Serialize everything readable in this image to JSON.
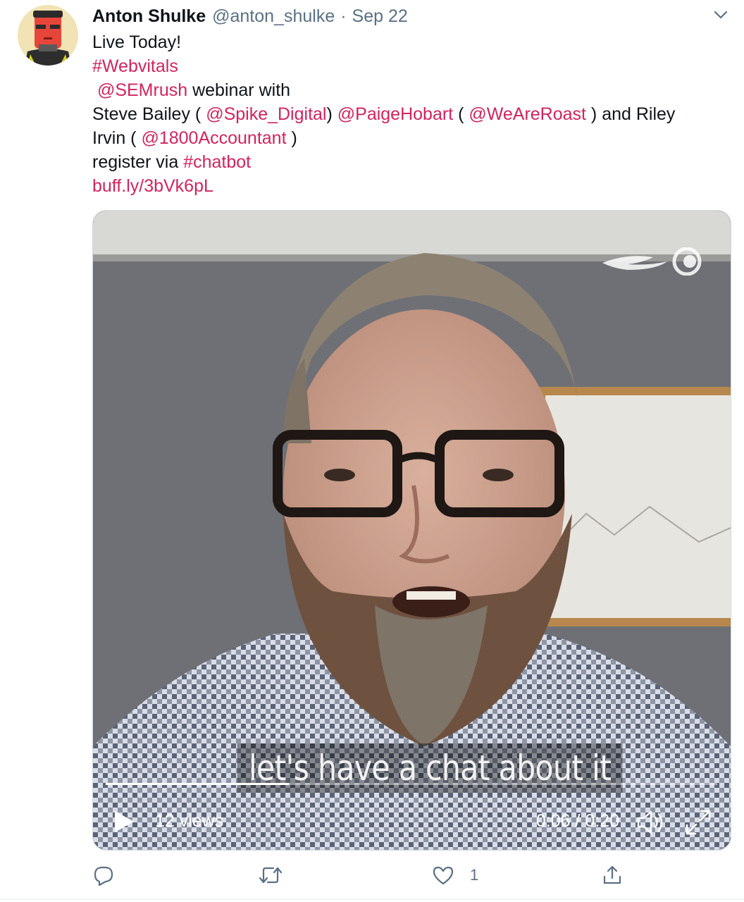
{
  "tweet": {
    "author_name": "Anton Shulke",
    "author_handle": "@anton_shulke",
    "separator": "·",
    "date": "Sep 22",
    "lines": {
      "l1": "Live Today!",
      "hashtag_webvitals": "#Webvitals",
      "mention_semrush": "@SEMrush",
      "l3_tail": " webinar with",
      "l4_a": "Steve Bailey ( ",
      "mention_spike": "@Spike_Digital",
      "l4_b": ") ",
      "mention_paige": "@PaigeHobart",
      "l4_c": " ( ",
      "mention_roast": "@WeAreRoast",
      "l4_d": " ) and Riley",
      "l5_a": "Irvin ( ",
      "mention_1800": "@1800Accountant",
      "l5_b": " )",
      "l6_a": "register via ",
      "hashtag_chatbot": "#chatbot",
      "short_link": "buff.ly/3bVk6pL"
    }
  },
  "video": {
    "caption": "let's have a chat about it",
    "views": "12 views",
    "time": "0:06 / 0:20",
    "progress": 0.3
  },
  "actions": {
    "likes_count": "1"
  },
  "icons": {
    "menu": "chevron-down-icon",
    "reply": "reply-icon",
    "retweet": "retweet-icon",
    "like": "heart-icon",
    "share": "share-icon",
    "play": "play-icon",
    "volume": "volume-icon",
    "fullscreen": "fullscreen-icon",
    "brand_logo": "semrush-logo"
  },
  "colors": {
    "link": "#d0245e",
    "secondary_text": "#5b7083"
  }
}
